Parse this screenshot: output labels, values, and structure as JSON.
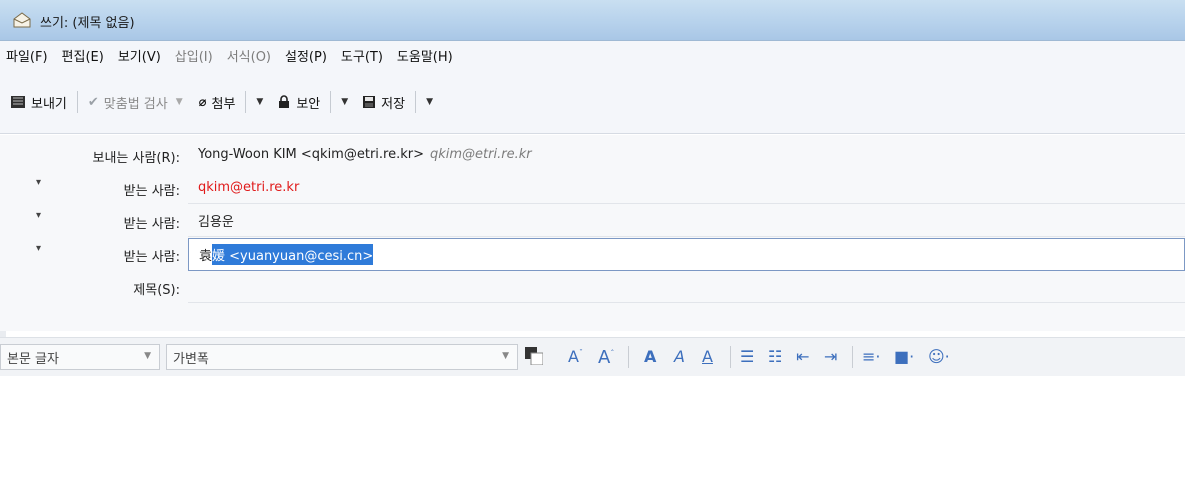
{
  "window": {
    "title": "쓰기: (제목 없음)"
  },
  "menu": [
    "파일(F)",
    "편집(E)",
    "보기(V)",
    "삽입(I)",
    "서식(O)",
    "설정(P)",
    "도구(T)",
    "도움말(H)"
  ],
  "toolbar": {
    "send": "보내기",
    "spell": "맞춤법 검사",
    "attach": "첨부",
    "security": "보안",
    "save": "저장"
  },
  "header": {
    "from_label": "보내는 사람(R):",
    "from_value": "Yong-Woon KIM <qkim@etri.re.kr>",
    "from_identity": "qkim@etri.re.kr",
    "to_label": "받는 사람:",
    "to1": "qkim@etri.re.kr",
    "to2": "김용운",
    "to3_typed": "袁",
    "to3_selected": "媛 <yuanyuan@cesi.cn>",
    "subject_label": "제목(S):",
    "subject_value": ""
  },
  "format": {
    "paragraph": "본문 글자",
    "font": "가변폭"
  }
}
